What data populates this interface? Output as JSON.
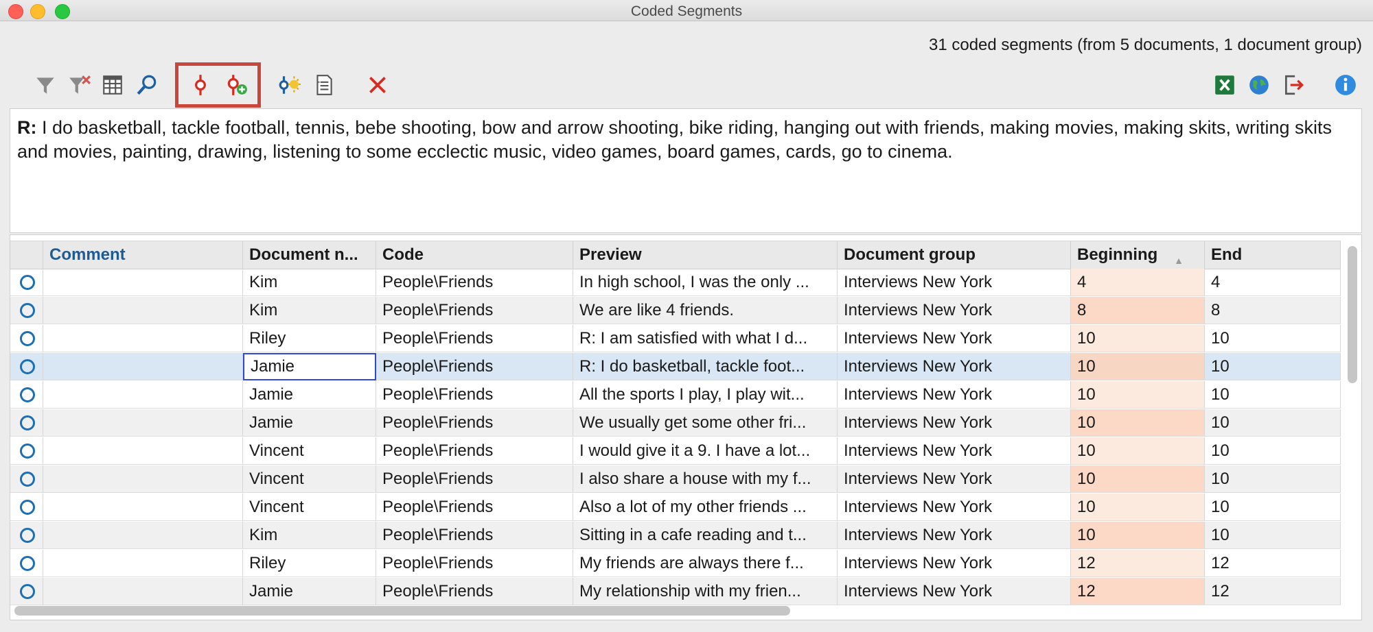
{
  "window": {
    "title": "Coded Segments"
  },
  "summary": "31 coded segments (from 5 documents, 1 document group)",
  "toolbar": {
    "icons": [
      "filter-icon",
      "clear-filter-icon",
      "columns-icon",
      "search-icon",
      "activate-segment-icon",
      "add-segment-icon",
      "smart-coding-icon",
      "list-icon",
      "delete-icon",
      "excel-export-icon",
      "web-export-icon",
      "export-icon",
      "info-icon"
    ],
    "accent_red": "#c9463a"
  },
  "preview_text": {
    "speaker": "R:",
    "text": " I do basketball, tackle football, tennis, bebe shooting, bow and arrow shooting, bike riding, hanging out with friends, making movies, making skits, writing skits and movies, painting, drawing, listening to some ecclectic music, video games, board games, cards, go to cinema."
  },
  "table": {
    "headers": [
      "Comment",
      "Document n...",
      "Code",
      "Preview",
      "Document group",
      "Beginning",
      "End"
    ],
    "rows": [
      {
        "doc": "Kim",
        "code": "People\\Friends",
        "preview": "In high school, I was the only ...",
        "group": "Interviews New York",
        "begin": "4",
        "end": "4"
      },
      {
        "doc": "Kim",
        "code": "People\\Friends",
        "preview": "We are like 4 friends.",
        "group": "Interviews New York",
        "begin": "8",
        "end": "8"
      },
      {
        "doc": "Riley",
        "code": "People\\Friends",
        "preview": "R: I am satisfied with what I d...",
        "group": "Interviews New York",
        "begin": "10",
        "end": "10"
      },
      {
        "doc": "Jamie",
        "code": "People\\Friends",
        "preview": "R: I do basketball, tackle foot...",
        "group": "Interviews New York",
        "begin": "10",
        "end": "10"
      },
      {
        "doc": "Jamie",
        "code": "People\\Friends",
        "preview": "All the sports I play, I play wit...",
        "group": "Interviews New York",
        "begin": "10",
        "end": "10"
      },
      {
        "doc": "Jamie",
        "code": "People\\Friends",
        "preview": "We usually get some other fri...",
        "group": "Interviews New York",
        "begin": "10",
        "end": "10"
      },
      {
        "doc": "Vincent",
        "code": "People\\Friends",
        "preview": "I would give it a 9. I have a lot...",
        "group": "Interviews New York",
        "begin": "10",
        "end": "10"
      },
      {
        "doc": "Vincent",
        "code": "People\\Friends",
        "preview": "I also share a house with my f...",
        "group": "Interviews New York",
        "begin": "10",
        "end": "10"
      },
      {
        "doc": "Vincent",
        "code": "People\\Friends",
        "preview": "Also a lot of my other friends ...",
        "group": "Interviews New York",
        "begin": "10",
        "end": "10"
      },
      {
        "doc": "Kim",
        "code": "People\\Friends",
        "preview": "Sitting in a cafe reading and t...",
        "group": "Interviews New York",
        "begin": "10",
        "end": "10"
      },
      {
        "doc": "Riley",
        "code": "People\\Friends",
        "preview": "My friends are always there f...",
        "group": "Interviews New York",
        "begin": "12",
        "end": "12"
      },
      {
        "doc": "Jamie",
        "code": "People\\Friends",
        "preview": "My relationship with my frien...",
        "group": "Interviews New York",
        "begin": "12",
        "end": "12"
      }
    ]
  }
}
